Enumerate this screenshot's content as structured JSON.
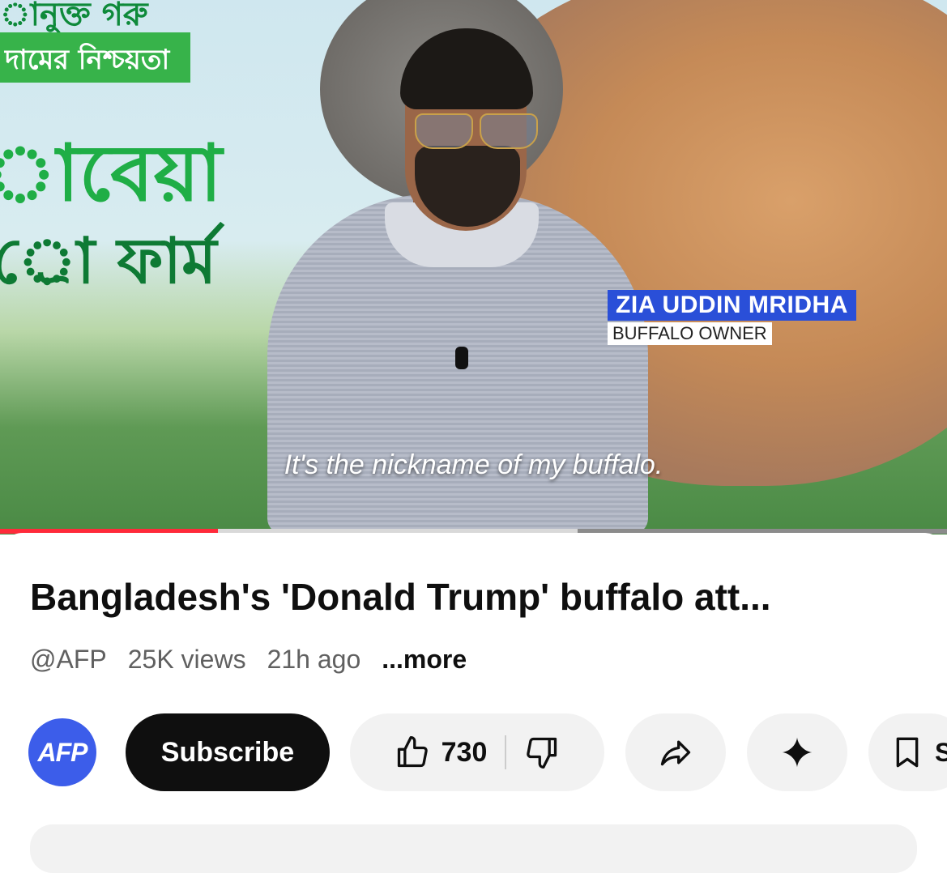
{
  "video": {
    "lower_third": {
      "name": "ZIA UDDIN MRIDHA",
      "title": "BUFFALO OWNER"
    },
    "subtitle": "It's the nickname of my buffalo.",
    "billboard_text": {
      "line1": "ানুক্ত গরু",
      "line2": "দামের নিশ্চয়তা",
      "line3": "াবেয়া",
      "line4": "্রো ফার্ম"
    },
    "progress": {
      "played_fraction": 0.23,
      "buffered_fraction": 0.61
    }
  },
  "details": {
    "title": "Bangladesh's 'Donald Trump' buffalo att...",
    "channel_handle": "@AFP",
    "views": "25K views",
    "age": "21h ago",
    "more_label": "...more"
  },
  "actions": {
    "avatar_text": "AFP",
    "subscribe_label": "Subscribe",
    "like_count": "730",
    "save_label": "S"
  },
  "colors": {
    "progress_red": "#ff2a3a",
    "avatar_blue": "#3c5dea",
    "lower_third_blue": "#2a4fd8"
  },
  "icons": [
    "like-icon",
    "dislike-icon",
    "share-icon",
    "remix-sparkle-icon",
    "save-bookmark-icon"
  ]
}
